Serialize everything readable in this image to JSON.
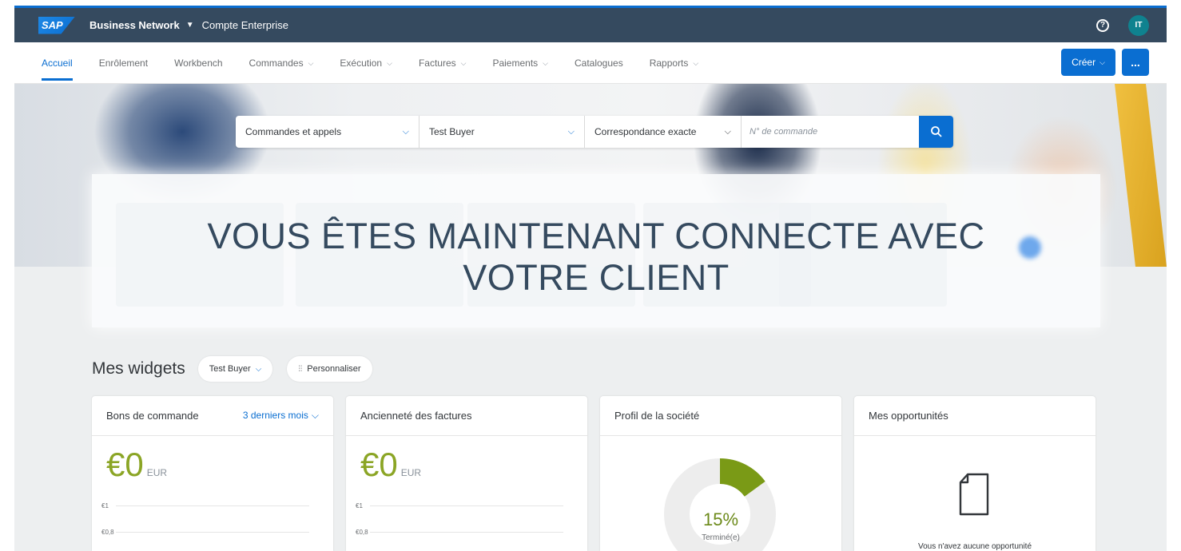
{
  "shell": {
    "logo": "SAP",
    "title": "Business Network",
    "account": "Compte Enterprise",
    "help_icon": "question-circle-icon",
    "avatar": "IT"
  },
  "nav": {
    "items": [
      {
        "label": "Accueil",
        "active": true
      },
      {
        "label": "Enrôlement",
        "dropdown": false
      },
      {
        "label": "Workbench",
        "dropdown": false
      },
      {
        "label": "Commandes",
        "dropdown": true
      },
      {
        "label": "Exécution",
        "dropdown": true
      },
      {
        "label": "Factures",
        "dropdown": true
      },
      {
        "label": "Paiements",
        "dropdown": true
      },
      {
        "label": "Catalogues",
        "dropdown": false
      },
      {
        "label": "Rapports",
        "dropdown": true
      }
    ],
    "create_label": "Créer",
    "more_label": "..."
  },
  "search": {
    "type_value": "Commandes et appels",
    "buyer_value": "Test Buyer",
    "match_value": "Correspondance exacte",
    "placeholder": "N° de commande"
  },
  "overlay": {
    "line1": "VOUS ÊTES MAINTENANT CONNECTE AVEC",
    "line2": "VOTRE CLIENT"
  },
  "widgets": {
    "title": "Mes widgets",
    "buyer_chip": "Test Buyer",
    "customize_label": "Personnaliser"
  },
  "cards": {
    "orders": {
      "title": "Bons de commande",
      "period": "3 derniers mois",
      "amount": "€0",
      "currency": "EUR",
      "ticks": [
        "€1",
        "€0,8"
      ]
    },
    "invoices": {
      "title": "Ancienneté des factures",
      "amount": "€0",
      "currency": "EUR",
      "ticks": [
        "€1",
        "€0,8"
      ]
    },
    "profile": {
      "title": "Profil de la société",
      "percent": "15%",
      "percent_value": 0.15,
      "status": "Terminé(e)"
    },
    "opportunities": {
      "title": "Mes opportunités",
      "empty_text": "Vous n'avez aucune opportunité"
    }
  },
  "colors": {
    "shell": "#354a5f",
    "accent": "#0a6ed1",
    "amount_green": "#8ba525",
    "donut_green": "#6c8a1a"
  }
}
